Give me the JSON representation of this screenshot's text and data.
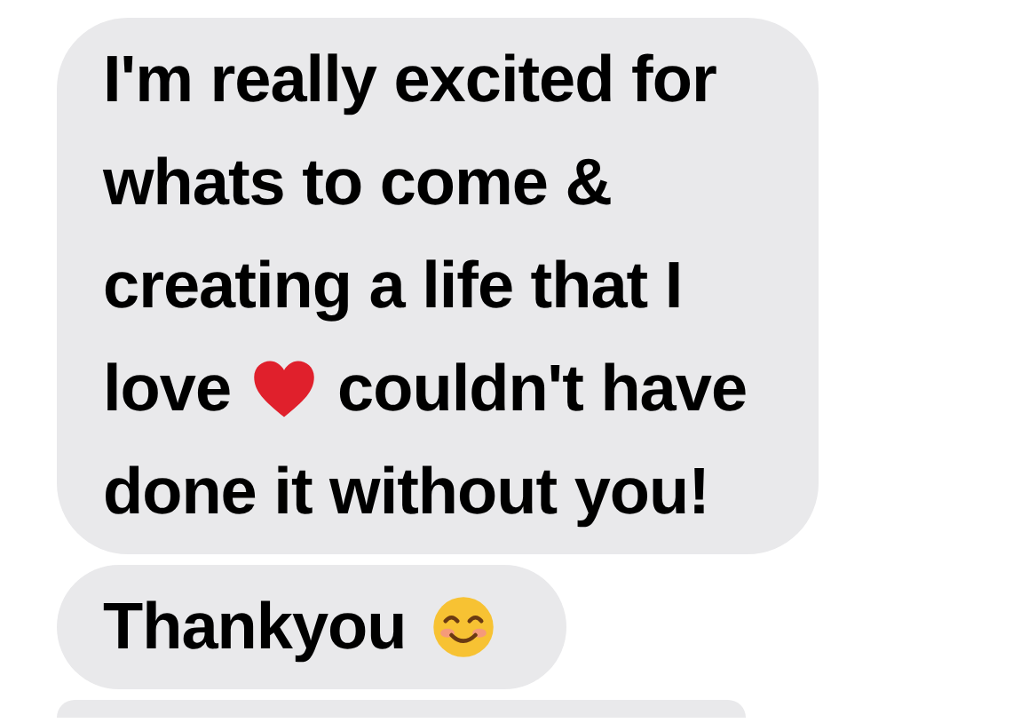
{
  "messages": [
    {
      "lines": [
        [
          {
            "kind": "text",
            "text": "I'm really excited for"
          }
        ],
        [
          {
            "kind": "text",
            "text": "whats to come &"
          }
        ],
        [
          {
            "kind": "text",
            "text": "creating a life that I"
          }
        ],
        [
          {
            "kind": "text",
            "text": "love"
          },
          {
            "kind": "heart"
          },
          {
            "kind": "text",
            "text": "couldn't have"
          }
        ],
        [
          {
            "kind": "text",
            "text": "done it without you!"
          }
        ]
      ]
    },
    {
      "lines": [
        [
          {
            "kind": "text",
            "text": "Thankyou"
          },
          {
            "kind": "smile"
          }
        ]
      ]
    }
  ]
}
